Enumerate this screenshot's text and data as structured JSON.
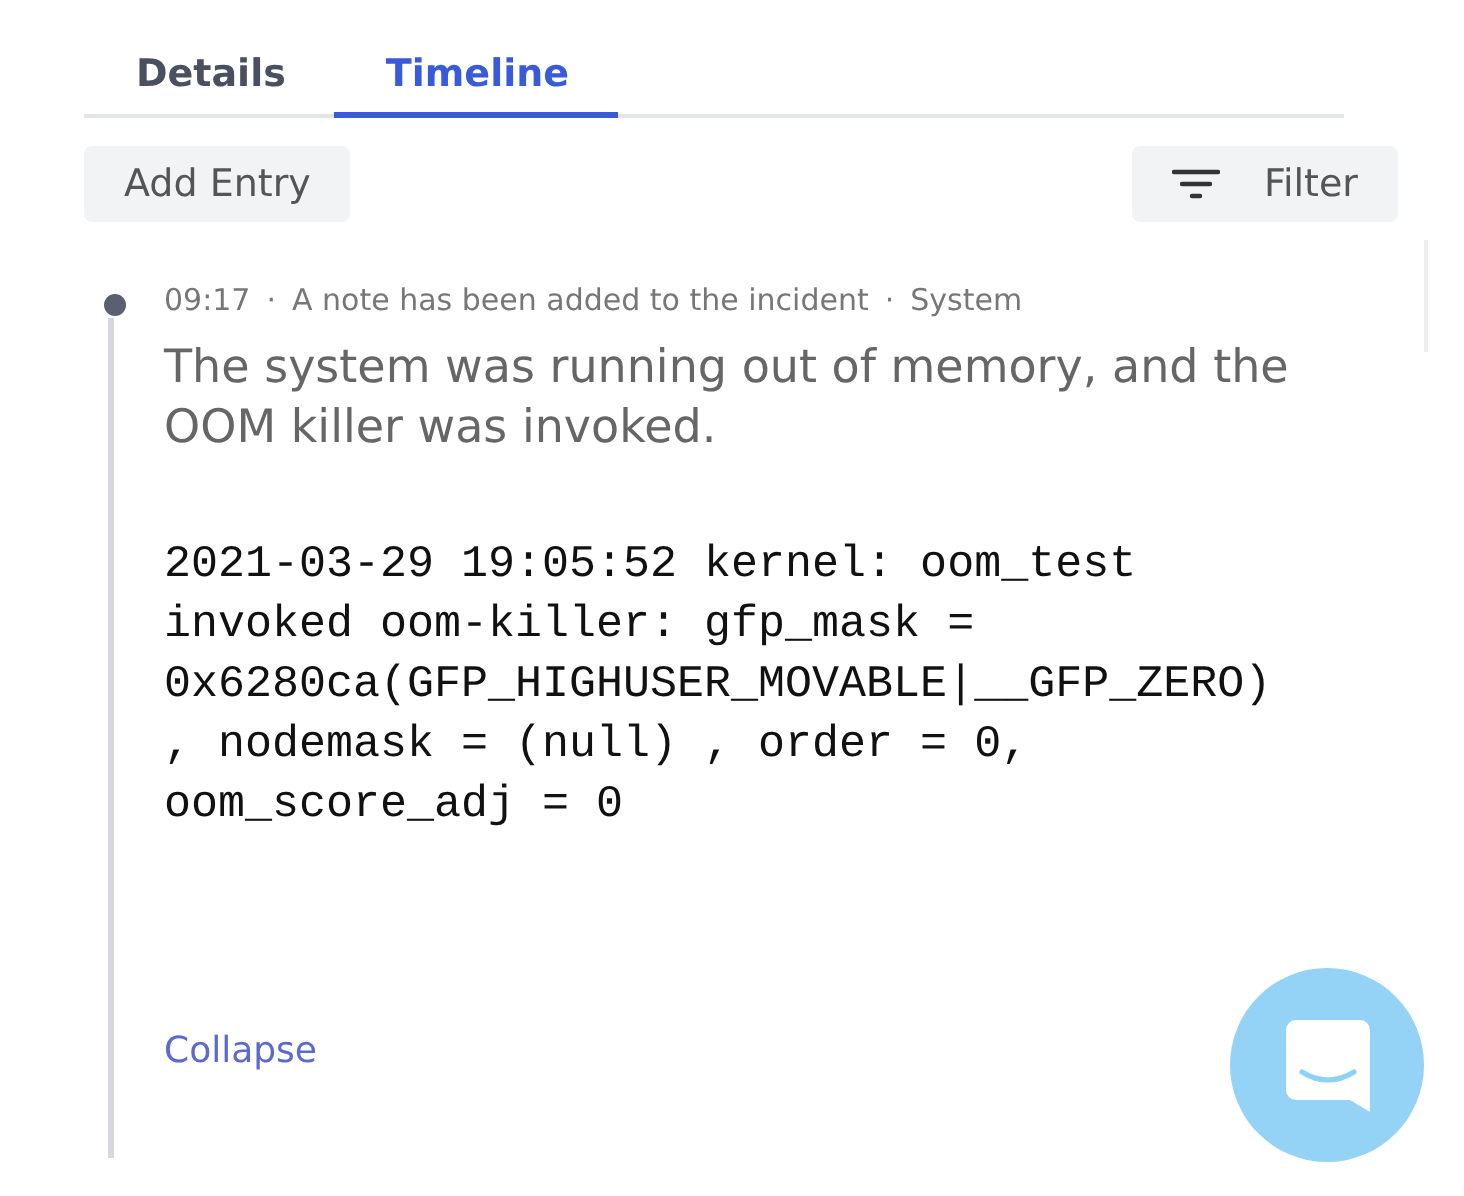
{
  "tabs": [
    {
      "label": "Details",
      "selected": false
    },
    {
      "label": "Timeline",
      "selected": true
    }
  ],
  "toolbar": {
    "add_button": "Add Entry",
    "filter_button": "Filter"
  },
  "entry": {
    "time": "09:17",
    "separator": "·",
    "title": "A note has been added to the incident",
    "author": "System",
    "note": "The system was running out of memory, and the OOM killer was invoked.",
    "log_lines": [
      "2021-03-29 19:05:52 kernel: oom_test",
      "invoked oom-killer: gfp_mask =",
      "0x6280ca(GFP_HIGHUSER_MOVABLE|__GFP_ZERO)",
      ", nodemask = (null) , order = 0,",
      "oom_score_adj = 0"
    ],
    "collapse_link": "Collapse"
  }
}
